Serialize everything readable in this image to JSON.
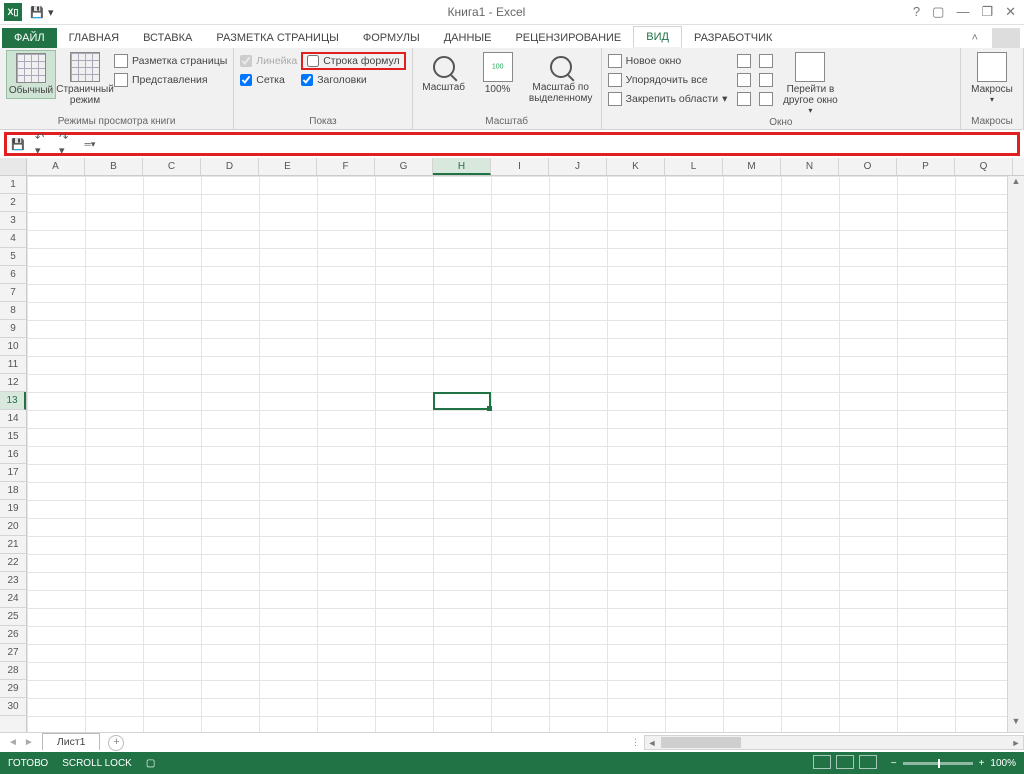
{
  "title": "Книга1 - Excel",
  "win": {
    "help": "?",
    "reserve": "▢",
    "min": "—",
    "restore": "❐",
    "close": "✕"
  },
  "tabs": [
    "ФАЙЛ",
    "ГЛАВНАЯ",
    "ВСТАВКА",
    "РАЗМЕТКА СТРАНИЦЫ",
    "ФОРМУЛЫ",
    "ДАННЫЕ",
    "РЕЦЕНЗИРОВАНИЕ",
    "ВИД",
    "РАЗРАБОТЧИК"
  ],
  "active_tab": "ВИД",
  "ribbon": {
    "groups": {
      "views": {
        "label": "Режимы просмотра книги",
        "normal": "Обычный",
        "pagebreak": "Страничный режим",
        "pagelayout": "Разметка страницы",
        "customviews": "Представления"
      },
      "show": {
        "label": "Показ",
        "ruler": "Линейка",
        "formulabar": "Строка формул",
        "gridlines": "Сетка",
        "headings": "Заголовки"
      },
      "zoom": {
        "label": "Масштаб",
        "zoom": "Масштаб",
        "p100": "100%",
        "tosel": "Масштаб по выделенному"
      },
      "window": {
        "label": "Окно",
        "neww": "Новое окно",
        "arrange": "Упорядочить все",
        "freeze": "Закрепить области",
        "switch": "Перейти в другое окно"
      },
      "macros": {
        "label": "Макросы",
        "macros": "Макросы"
      }
    }
  },
  "columns": [
    "A",
    "B",
    "C",
    "D",
    "E",
    "F",
    "G",
    "H",
    "I",
    "J",
    "K",
    "L",
    "M",
    "N",
    "O",
    "P",
    "Q"
  ],
  "selected_col": "H",
  "rows": 30,
  "selected_row": 13,
  "sheet": {
    "name": "Лист1",
    "add": "+"
  },
  "status": {
    "ready": "ГОТОВО",
    "scroll": "SCROLL LOCK",
    "zoom": "100%",
    "minus": "−",
    "plus": "+"
  }
}
